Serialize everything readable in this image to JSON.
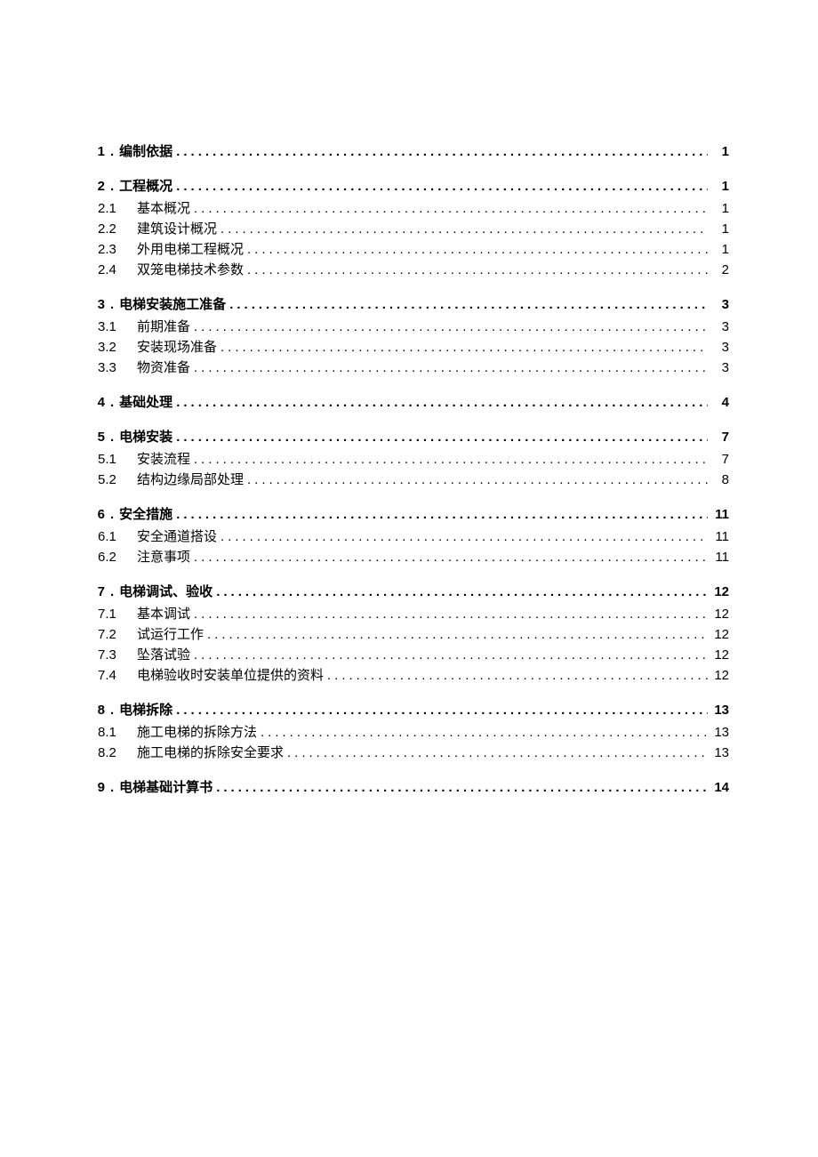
{
  "toc": [
    {
      "num": "1",
      "title": "编制依据",
      "page": "1",
      "sub": []
    },
    {
      "num": "2",
      "title": "工程概况",
      "page": "1",
      "sub": [
        {
          "num": "2.1",
          "title": "基本概况",
          "page": "1"
        },
        {
          "num": "2.2",
          "title": "建筑设计概况",
          "page": "1"
        },
        {
          "num": "2.3",
          "title": "外用电梯工程概况",
          "page": "1"
        },
        {
          "num": "2.4",
          "title": "双笼电梯技术参数",
          "page": "2"
        }
      ]
    },
    {
      "num": "3",
      "title": "电梯安装施工准备",
      "page": "3",
      "sub": [
        {
          "num": "3.1",
          "title": "前期准备",
          "page": "3"
        },
        {
          "num": "3.2",
          "title": "安装现场准备",
          "page": "3"
        },
        {
          "num": "3.3",
          "title": "物资准备",
          "page": "3"
        }
      ]
    },
    {
      "num": "4",
      "title": "基础处理",
      "page": "4",
      "sub": []
    },
    {
      "num": "5",
      "title": "电梯安装",
      "page": "7",
      "sub": [
        {
          "num": "5.1",
          "title": "安装流程",
          "page": "7"
        },
        {
          "num": "5.2",
          "title": "结构边缘局部处理",
          "page": "8"
        }
      ]
    },
    {
      "num": "6",
      "title": "安全措施",
      "page": "11",
      "sub": [
        {
          "num": "6.1",
          "title": "安全通道搭设",
          "page": "11"
        },
        {
          "num": "6.2",
          "title": "注意事项",
          "page": "11"
        }
      ]
    },
    {
      "num": "7",
      "title": "电梯调试、验收",
      "page": "12",
      "sub": [
        {
          "num": "7.1",
          "title": "基本调试",
          "page": "12"
        },
        {
          "num": "7.2",
          "title": "试运行工作",
          "page": "12"
        },
        {
          "num": "7.3",
          "title": "坠落试验",
          "page": "12"
        },
        {
          "num": "7.4",
          "title": "电梯验收时安装单位提供的资料",
          "page": "12"
        }
      ]
    },
    {
      "num": "8",
      "title": "电梯拆除",
      "page": "13",
      "sub": [
        {
          "num": "8.1",
          "title": "施工电梯的拆除方法",
          "page": "13"
        },
        {
          "num": "8.2",
          "title": "施工电梯的拆除安全要求",
          "page": "13"
        }
      ]
    },
    {
      "num": "9",
      "title": "电梯基础计算书",
      "page": "14",
      "sub": []
    }
  ]
}
